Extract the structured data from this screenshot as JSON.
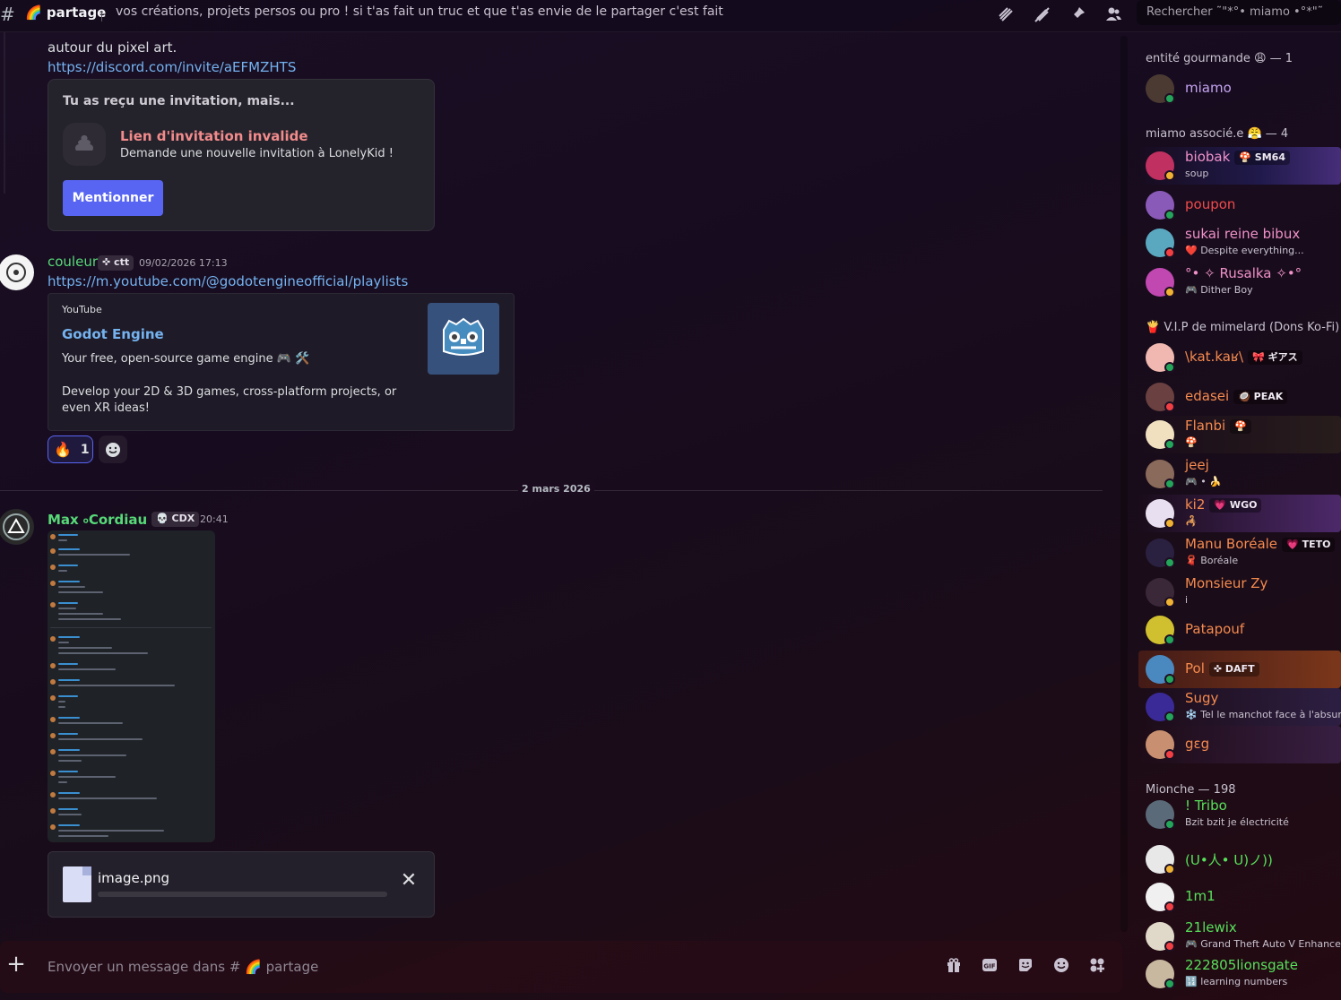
{
  "header": {
    "channel_name": "🌈 partage",
    "topic": "vos créations, projets persos ou pro ! si t'as fait un truc et que t'as envie de le partager c'est fait pour ✨",
    "search_placeholder": "Rechercher ˜\"*°• miamo •°*\"˜"
  },
  "messages": {
    "prev_text": "autour du pixel art.",
    "prev_link": "https://discord.com/invite/aEFMZHTS",
    "invite": {
      "title": "Tu as reçu une invitation, mais...",
      "error": "Lien d'invitation invalide",
      "sub": "Demande une nouvelle invitation à LonelyKid !",
      "button": "Mentionner"
    },
    "msg1": {
      "author": "couleur",
      "tag": "ctt",
      "time": "09/02/2026 17:13",
      "link": "https://m.youtube.com/@godotengineofficial/playlists",
      "embed": {
        "provider": "YouTube",
        "title": "Godot Engine",
        "desc1": "Your free, open-source game engine 🎮 🛠️",
        "desc2": "Develop your 2D & 3D games, cross-platform projects, or even XR ideas!"
      },
      "reaction_emoji": "🔥",
      "reaction_count": "1"
    },
    "date_divider": "2 mars 2026",
    "msg2": {
      "author": "Max ৹Cordiau",
      "tag": "CDX",
      "time": "20:41"
    },
    "upload": {
      "filename": "image.png",
      "progress": 0
    }
  },
  "composer": {
    "placeholder": "Envoyer un message dans # 🌈 partage"
  },
  "members": {
    "roles": [
      {
        "label": "entité gourmande 😩 — 1"
      },
      {
        "label": "miamo associé.e 😤 — 4"
      },
      {
        "label": "🍟 V.I.P de mimelard (Dons Ko-Fi) —"
      },
      {
        "label": "Mionche — 198"
      }
    ],
    "list": [
      {
        "name": "miamo",
        "sub": "",
        "tag": "",
        "color": "#c4a2f0",
        "av": "#4a3a32",
        "status": "#23a55a"
      },
      {
        "name": "biobak",
        "sub": "soup",
        "tag": "🍄 SM64",
        "color": "#f091c8",
        "av": "#c03060",
        "status": "#f0b232"
      },
      {
        "name": "poupon",
        "sub": "",
        "tag": "",
        "color": "#f04b4b",
        "av": "#8a5ab8",
        "status": "#23a55a"
      },
      {
        "name": "sukai reine bibux",
        "sub": "❤️ Despite everything...",
        "tag": "",
        "color": "#f091c8",
        "av": "#5aa8c0",
        "status": "#f23f43"
      },
      {
        "name": "°• ✧ Rusalka ✧•°",
        "sub": "🎮 Dither Boy",
        "tag": "",
        "color": "#f091c8",
        "av": "#c048b0",
        "status": "#f0b232"
      },
      {
        "name": "\\kat.kaʁ\\",
        "sub": "",
        "tag": "🎀 ギアス",
        "color": "#f58a4e",
        "av": "#f0b8b0",
        "status": "#23a55a"
      },
      {
        "name": "edasei",
        "sub": "",
        "tag": "🥥 PEAK",
        "color": "#f58a4e",
        "av": "#6a4040",
        "status": "#f23f43"
      },
      {
        "name": "Flanbi",
        "sub": "🍄",
        "tag": "🍄",
        "color": "#f58a4e",
        "av": "#f0e0c0",
        "status": "#23a55a"
      },
      {
        "name": "jeej",
        "sub": "🎮 • 🍌",
        "tag": "",
        "color": "#f58a4e",
        "av": "#8a6a5a",
        "status": "#23a55a"
      },
      {
        "name": "ki2",
        "sub": "🦂",
        "tag": "💗 WGO",
        "color": "#f58a4e",
        "av": "#e8e0f0",
        "status": "#f0b232"
      },
      {
        "name": "Manu Boréale",
        "sub": "🧣 Boréale",
        "tag": "💗 TETO",
        "color": "#f58a4e",
        "av": "#2a2040",
        "status": "#23a55a"
      },
      {
        "name": "Monsieur Zy",
        "sub": "i",
        "tag": "",
        "color": "#f58a4e",
        "av": "#3a2838",
        "status": "#f0b232"
      },
      {
        "name": "Patapouf",
        "sub": "",
        "tag": "",
        "color": "#f58a4e",
        "av": "#d0c030",
        "status": "#23a55a"
      },
      {
        "name": "Pol",
        "sub": "",
        "tag": "✜ DAFT",
        "color": "#f58a4e",
        "av": "#4a88c0",
        "status": "#23a55a"
      },
      {
        "name": "Sugy",
        "sub": "❄️ Tel le manchot face à l'absur",
        "tag": "",
        "color": "#f58a4e",
        "av": "#3a2a98",
        "status": "#23a55a"
      },
      {
        "name": "gɛg",
        "sub": "",
        "tag": "",
        "color": "#f58a4e",
        "av": "#c89070",
        "status": "#f23f43"
      },
      {
        "name": "! Tribo",
        "sub": "Bzit bzit je électricité",
        "tag": "",
        "color": "#57e05a",
        "av": "#5a6a78",
        "status": "#23a55a"
      },
      {
        "name": "(U•人• U)ノ))",
        "sub": "",
        "tag": "",
        "color": "#57e05a",
        "av": "#e8e8e8",
        "status": "#f0b232"
      },
      {
        "name": "1m1",
        "sub": "",
        "tag": "",
        "color": "#57e05a",
        "av": "#f0f0f0",
        "status": "#f23f43"
      },
      {
        "name": "21lewix",
        "sub": "🎮 Grand Theft Auto V Enhanced",
        "tag": "",
        "color": "#57e05a",
        "av": "#e0d8c8",
        "status": "#f23f43"
      },
      {
        "name": "222805lionsgate",
        "sub": "🔢 learning numbers",
        "tag": "",
        "color": "#57e05a",
        "av": "#c8b8a0",
        "status": "#23a55a"
      }
    ]
  }
}
